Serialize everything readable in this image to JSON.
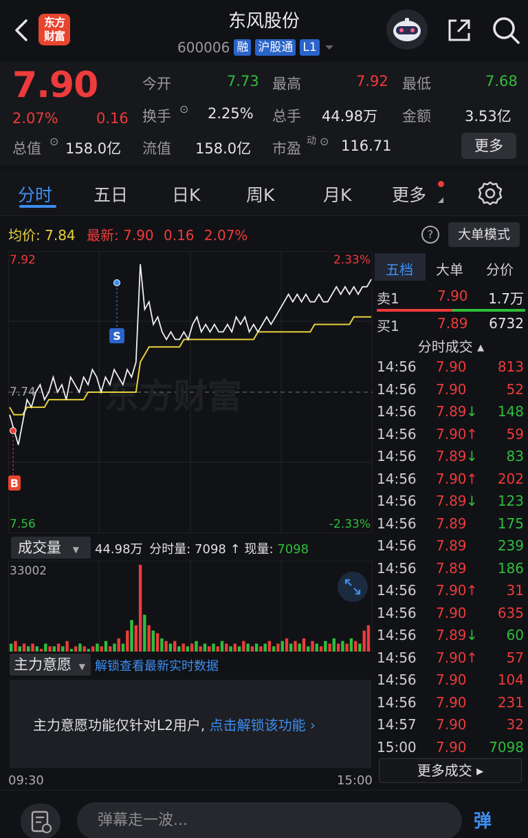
{
  "header": {
    "title": "东风股份",
    "code": "600006",
    "tags": [
      "融",
      "沪股通",
      "L1"
    ],
    "logo_text": [
      "东方",
      "财富"
    ]
  },
  "quote": {
    "price": "7.90",
    "change_pct": "2.07%",
    "change": "0.16",
    "total_value_label": "总值",
    "total_value": "158.0亿",
    "open_label": "今开",
    "open": "7.73",
    "high_label": "最高",
    "high": "7.92",
    "low_label": "最低",
    "low": "7.68",
    "turnover_label": "换手",
    "turnover": "2.25%",
    "volume_label": "总手",
    "volume": "44.98万",
    "amount_label": "金额",
    "amount": "3.53亿",
    "float_label": "流值",
    "float_value": "158.0亿",
    "pe_label": "市盈",
    "pe_sup": "动",
    "pe": "116.71",
    "more_label": "更多"
  },
  "tabs": [
    "分时",
    "五日",
    "日K",
    "周K",
    "月K",
    "更多"
  ],
  "info_line": {
    "avg_label": "均价:",
    "avg": "7.84",
    "latest_label": "最新:",
    "latest": "7.90",
    "latest_change": "0.16",
    "latest_pct": "2.07%",
    "help": "?",
    "big_order_mode": "大单模式"
  },
  "chart_data": {
    "type": "line",
    "title": "",
    "y_top_label": "7.92",
    "y_mid_label": "7.74",
    "y_bottom_label": "7.56",
    "pct_top_label": "2.33%",
    "pct_bottom_label": "-2.33%",
    "ylim": [
      7.56,
      7.92
    ],
    "prev_close": 7.74,
    "x_start": "09:30",
    "x_end": "15:00",
    "buy_marker": "B",
    "sell_marker": "S",
    "watermark": "东方财富",
    "series": [
      {
        "values": [
          7.71,
          7.69,
          7.67,
          7.7,
          7.73,
          7.72,
          7.74,
          7.75,
          7.73,
          7.74,
          7.76,
          7.74,
          7.75,
          7.73,
          7.76,
          7.75,
          7.74,
          7.76,
          7.75,
          7.77,
          7.76,
          7.74,
          7.76,
          7.75,
          7.77,
          7.76,
          7.75,
          7.77,
          7.76,
          7.78,
          7.91,
          7.85,
          7.86,
          7.83,
          7.84,
          7.82,
          7.81,
          7.82,
          7.81,
          7.81,
          7.82,
          7.81,
          7.83,
          7.84,
          7.82,
          7.83,
          7.82,
          7.83,
          7.82,
          7.82,
          7.83,
          7.82,
          7.84,
          7.83,
          7.84,
          7.82,
          7.83,
          7.82,
          7.83,
          7.84,
          7.83,
          7.84,
          7.85,
          7.86,
          7.87,
          7.86,
          7.87,
          7.86,
          7.87,
          7.86,
          7.86,
          7.87,
          7.86,
          7.86,
          7.87,
          7.88,
          7.87,
          7.88,
          7.87,
          7.88,
          7.87,
          7.88,
          7.88,
          7.89
        ]
      },
      {
        "values": [
          7.72,
          7.71,
          7.71,
          7.71,
          7.72,
          7.72,
          7.72,
          7.72,
          7.72,
          7.73,
          7.73,
          7.73,
          7.73,
          7.73,
          7.73,
          7.73,
          7.73,
          7.73,
          7.74,
          7.74,
          7.74,
          7.74,
          7.74,
          7.74,
          7.74,
          7.74,
          7.74,
          7.74,
          7.74,
          7.74,
          7.78,
          7.79,
          7.8,
          7.8,
          7.8,
          7.8,
          7.8,
          7.8,
          7.8,
          7.8,
          7.81,
          7.81,
          7.81,
          7.81,
          7.81,
          7.81,
          7.81,
          7.81,
          7.81,
          7.81,
          7.81,
          7.81,
          7.81,
          7.81,
          7.81,
          7.81,
          7.81,
          7.82,
          7.82,
          7.82,
          7.82,
          7.82,
          7.82,
          7.82,
          7.82,
          7.82,
          7.82,
          7.82,
          7.82,
          7.82,
          7.83,
          7.83,
          7.83,
          7.83,
          7.83,
          7.83,
          7.83,
          7.83,
          7.83,
          7.84,
          7.84,
          7.84,
          7.84,
          7.84
        ]
      }
    ],
    "volume_max_label": "33002",
    "volume": [
      {
        "v": 3,
        "c": "g"
      },
      {
        "v": 4,
        "c": "r"
      },
      {
        "v": 2,
        "c": "g"
      },
      {
        "v": 3,
        "c": "r"
      },
      {
        "v": 2,
        "c": "g"
      },
      {
        "v": 3,
        "c": "r"
      },
      {
        "v": 2,
        "c": "g"
      },
      {
        "v": 1,
        "c": "r"
      },
      {
        "v": 3,
        "c": "g"
      },
      {
        "v": 2,
        "c": "r"
      },
      {
        "v": 2,
        "c": "g"
      },
      {
        "v": 3,
        "c": "r"
      },
      {
        "v": 2,
        "c": "g"
      },
      {
        "v": 4,
        "c": "r"
      },
      {
        "v": 1,
        "c": "g"
      },
      {
        "v": 2,
        "c": "r"
      },
      {
        "v": 3,
        "c": "g"
      },
      {
        "v": 2,
        "c": "r"
      },
      {
        "v": 1,
        "c": "g"
      },
      {
        "v": 2,
        "c": "r"
      },
      {
        "v": 3,
        "c": "g"
      },
      {
        "v": 2,
        "c": "r"
      },
      {
        "v": 4,
        "c": "g"
      },
      {
        "v": 2,
        "c": "r"
      },
      {
        "v": 3,
        "c": "g"
      },
      {
        "v": 5,
        "c": "r"
      },
      {
        "v": 3,
        "c": "g"
      },
      {
        "v": 8,
        "c": "r"
      },
      {
        "v": 12,
        "c": "g"
      },
      {
        "v": 10,
        "c": "r"
      },
      {
        "v": 33,
        "c": "r"
      },
      {
        "v": 14,
        "c": "g"
      },
      {
        "v": 10,
        "c": "r"
      },
      {
        "v": 8,
        "c": "g"
      },
      {
        "v": 7,
        "c": "r"
      },
      {
        "v": 5,
        "c": "g"
      },
      {
        "v": 4,
        "c": "r"
      },
      {
        "v": 3,
        "c": "g"
      },
      {
        "v": 4,
        "c": "r"
      },
      {
        "v": 2,
        "c": "g"
      },
      {
        "v": 3,
        "c": "r"
      },
      {
        "v": 2,
        "c": "g"
      },
      {
        "v": 3,
        "c": "r"
      },
      {
        "v": 4,
        "c": "g"
      },
      {
        "v": 2,
        "c": "r"
      },
      {
        "v": 3,
        "c": "g"
      },
      {
        "v": 2,
        "c": "r"
      },
      {
        "v": 3,
        "c": "g"
      },
      {
        "v": 2,
        "c": "r"
      },
      {
        "v": 4,
        "c": "g"
      },
      {
        "v": 3,
        "c": "r"
      },
      {
        "v": 2,
        "c": "g"
      },
      {
        "v": 3,
        "c": "r"
      },
      {
        "v": 2,
        "c": "g"
      },
      {
        "v": 4,
        "c": "r"
      },
      {
        "v": 3,
        "c": "g"
      },
      {
        "v": 2,
        "c": "r"
      },
      {
        "v": 3,
        "c": "g"
      },
      {
        "v": 2,
        "c": "r"
      },
      {
        "v": 3,
        "c": "g"
      },
      {
        "v": 4,
        "c": "r"
      },
      {
        "v": 2,
        "c": "g"
      },
      {
        "v": 3,
        "c": "r"
      },
      {
        "v": 4,
        "c": "g"
      },
      {
        "v": 5,
        "c": "r"
      },
      {
        "v": 3,
        "c": "g"
      },
      {
        "v": 4,
        "c": "r"
      },
      {
        "v": 3,
        "c": "g"
      },
      {
        "v": 5,
        "c": "r"
      },
      {
        "v": 2,
        "c": "g"
      },
      {
        "v": 4,
        "c": "r"
      },
      {
        "v": 3,
        "c": "g"
      },
      {
        "v": 2,
        "c": "r"
      },
      {
        "v": 4,
        "c": "g"
      },
      {
        "v": 3,
        "c": "r"
      },
      {
        "v": 5,
        "c": "g"
      },
      {
        "v": 3,
        "c": "r"
      },
      {
        "v": 4,
        "c": "g"
      },
      {
        "v": 3,
        "c": "r"
      },
      {
        "v": 5,
        "c": "g"
      },
      {
        "v": 4,
        "c": "r"
      },
      {
        "v": 3,
        "c": "g"
      },
      {
        "v": 8,
        "c": "r"
      },
      {
        "v": 10,
        "c": "r"
      }
    ]
  },
  "volume_bar": {
    "select_label": "成交量",
    "total": "44.98万",
    "minute_label": "分时量:",
    "minute_value": "7098",
    "arrow": "↑",
    "now_label": "现量:",
    "now_value": "7098"
  },
  "main_intent": {
    "select_label": "主力意愿",
    "unlock_link": "解锁查看最新实时数据",
    "message": "主力意愿功能仅针对L2用户,",
    "message_link": "点击解锁该功能 ›"
  },
  "right_panel": {
    "tabs": [
      "五档",
      "大单",
      "分价"
    ],
    "sell1": {
      "label": "卖1",
      "price": "7.90",
      "vol": "1.7万"
    },
    "buy1": {
      "label": "买1",
      "price": "7.89",
      "vol": "6732"
    },
    "section_title": "分时成交 ▴",
    "trades": [
      {
        "time": "14:56",
        "price": "7.90",
        "arrow": "",
        "vol": "813",
        "vc": "r",
        "pc": "r"
      },
      {
        "time": "14:56",
        "price": "7.90",
        "arrow": "",
        "vol": "52",
        "vc": "r",
        "pc": "r"
      },
      {
        "time": "14:56",
        "price": "7.89",
        "arrow": "↓",
        "vol": "148",
        "vc": "g",
        "pc": "r"
      },
      {
        "time": "14:56",
        "price": "7.90",
        "arrow": "↑",
        "vol": "59",
        "vc": "r",
        "pc": "r"
      },
      {
        "time": "14:56",
        "price": "7.89",
        "arrow": "↓",
        "vol": "83",
        "vc": "g",
        "pc": "r"
      },
      {
        "time": "14:56",
        "price": "7.90",
        "arrow": "↑",
        "vol": "202",
        "vc": "r",
        "pc": "r"
      },
      {
        "time": "14:56",
        "price": "7.89",
        "arrow": "↓",
        "vol": "123",
        "vc": "g",
        "pc": "r"
      },
      {
        "time": "14:56",
        "price": "7.89",
        "arrow": "",
        "vol": "175",
        "vc": "g",
        "pc": "r"
      },
      {
        "time": "14:56",
        "price": "7.89",
        "arrow": "",
        "vol": "239",
        "vc": "g",
        "pc": "r"
      },
      {
        "time": "14:56",
        "price": "7.89",
        "arrow": "",
        "vol": "186",
        "vc": "g",
        "pc": "r"
      },
      {
        "time": "14:56",
        "price": "7.90",
        "arrow": "↑",
        "vol": "31",
        "vc": "r",
        "pc": "r"
      },
      {
        "time": "14:56",
        "price": "7.90",
        "arrow": "",
        "vol": "635",
        "vc": "r",
        "pc": "r"
      },
      {
        "time": "14:56",
        "price": "7.89",
        "arrow": "↓",
        "vol": "60",
        "vc": "g",
        "pc": "r"
      },
      {
        "time": "14:56",
        "price": "7.90",
        "arrow": "↑",
        "vol": "57",
        "vc": "r",
        "pc": "r"
      },
      {
        "time": "14:56",
        "price": "7.90",
        "arrow": "",
        "vol": "104",
        "vc": "r",
        "pc": "r"
      },
      {
        "time": "14:56",
        "price": "7.90",
        "arrow": "",
        "vol": "231",
        "vc": "r",
        "pc": "r"
      },
      {
        "time": "14:57",
        "price": "7.90",
        "arrow": "",
        "vol": "32",
        "vc": "r",
        "pc": "r"
      },
      {
        "time": "15:00",
        "price": "7.90",
        "arrow": "",
        "vol": "7098",
        "vc": "g",
        "pc": "r"
      }
    ],
    "more_trades": "更多成交 ▸"
  },
  "bottom": {
    "placeholder": "弹幕走一波...",
    "danmu_btn": "弹"
  },
  "colors": {
    "up": "#ee3b3b",
    "down": "#2fbf3b",
    "avg": "#e9d23b",
    "accent": "#3d8ef0"
  }
}
